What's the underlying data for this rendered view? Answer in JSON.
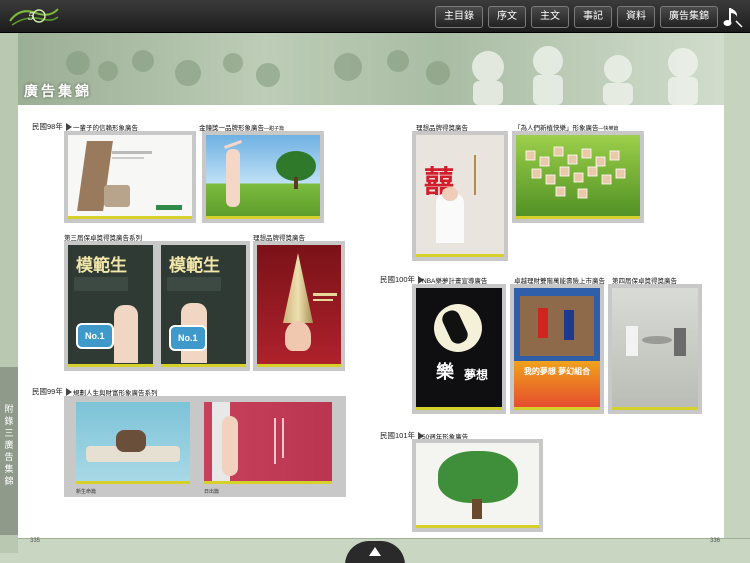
{
  "nav": {
    "buttons": [
      "主目錄",
      "序文",
      "主文",
      "事記",
      "資料",
      "廣告集錦"
    ]
  },
  "banner_title": "廣告集錦",
  "side_tab_text": "附\n錄\n三\n廣\n告\n集\n錦",
  "page_numbers": {
    "left": "335",
    "right": "336"
  },
  "years": {
    "y98": "民國98年",
    "y99": "民國99年",
    "y100": "民國100年",
    "y101": "民國101年"
  },
  "labels": {
    "l1": "一輩子的信賴形象廣告",
    "l2": "金鐘獎一品牌形象廣告",
    "l2_sub": "—甜子篇",
    "l3": "第三屆保卓獎得獎廣告系列",
    "l4": "理想品牌得獎廣告",
    "l5": "理想品牌得獎廣告",
    "l6": "「為人們新植快樂」形象廣告",
    "l6_sub": "—快樂篇",
    "l7": "規劃人生與財富形象廣告系列",
    "l8": "NBA樂夢計畫宣導廣告",
    "l9": "卓越理財雙階萬能壽險上市廣告",
    "l10": "第四屆保卓獎得獎廣告",
    "l11": "50週年形象廣告"
  },
  "ad_text": {
    "mofan1": "模範生",
    "mofan2": "模範生",
    "no1a": "No.1",
    "no1b": "No.1",
    "xi": "囍",
    "cap1": "新生命篇",
    "cap2": "日出篇",
    "nba": "夢想",
    "nba2": "樂",
    "poster": "我的夢想 夢幻組合"
  },
  "colors": {
    "topbar": "#222222",
    "frame": "#c8c8c8",
    "accent_yellow": "#d6d12a",
    "banner_green": "#9eb498"
  }
}
